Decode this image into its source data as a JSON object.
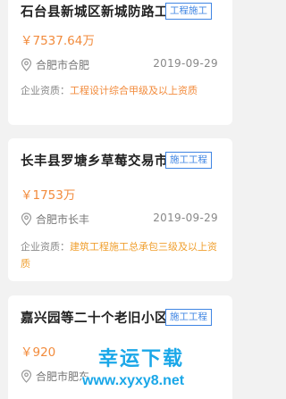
{
  "projects": [
    {
      "title": "石台县新城区新城防路工程",
      "tag": "工程施工",
      "amount": "￥7537.64万",
      "location": "合肥市合肥",
      "date": "2019-09-29",
      "qual_label": "企业资质：",
      "qual_value": "工程设计综合甲级及以上资质",
      "qual_color": "#f28b3c"
    },
    {
      "title": "长丰县罗塘乡草莓交易市场...",
      "tag": "施工工程",
      "amount": "￥1753万",
      "location": "合肥市长丰",
      "date": "2019-09-29",
      "qual_label": "企业资质：",
      "qual_value": "建筑工程施工总承包三级及以上资质",
      "qual_color": "#f0a030"
    },
    {
      "title": "嘉兴园等二十个老旧小区改...",
      "tag": "施工工程",
      "amount": "￥920",
      "location": "合肥市肥东",
      "date": "",
      "qual_label": "",
      "qual_value": "",
      "qual_color": "#f0a030"
    }
  ],
  "watermark": {
    "title": "幸运下载",
    "url": "www.xyxy8.net"
  },
  "icons": {
    "location": "location-pin-icon"
  },
  "colors": {
    "tag": "#3f85e3",
    "amount": "#f28b3c",
    "watermark": "#1aa7e8"
  }
}
